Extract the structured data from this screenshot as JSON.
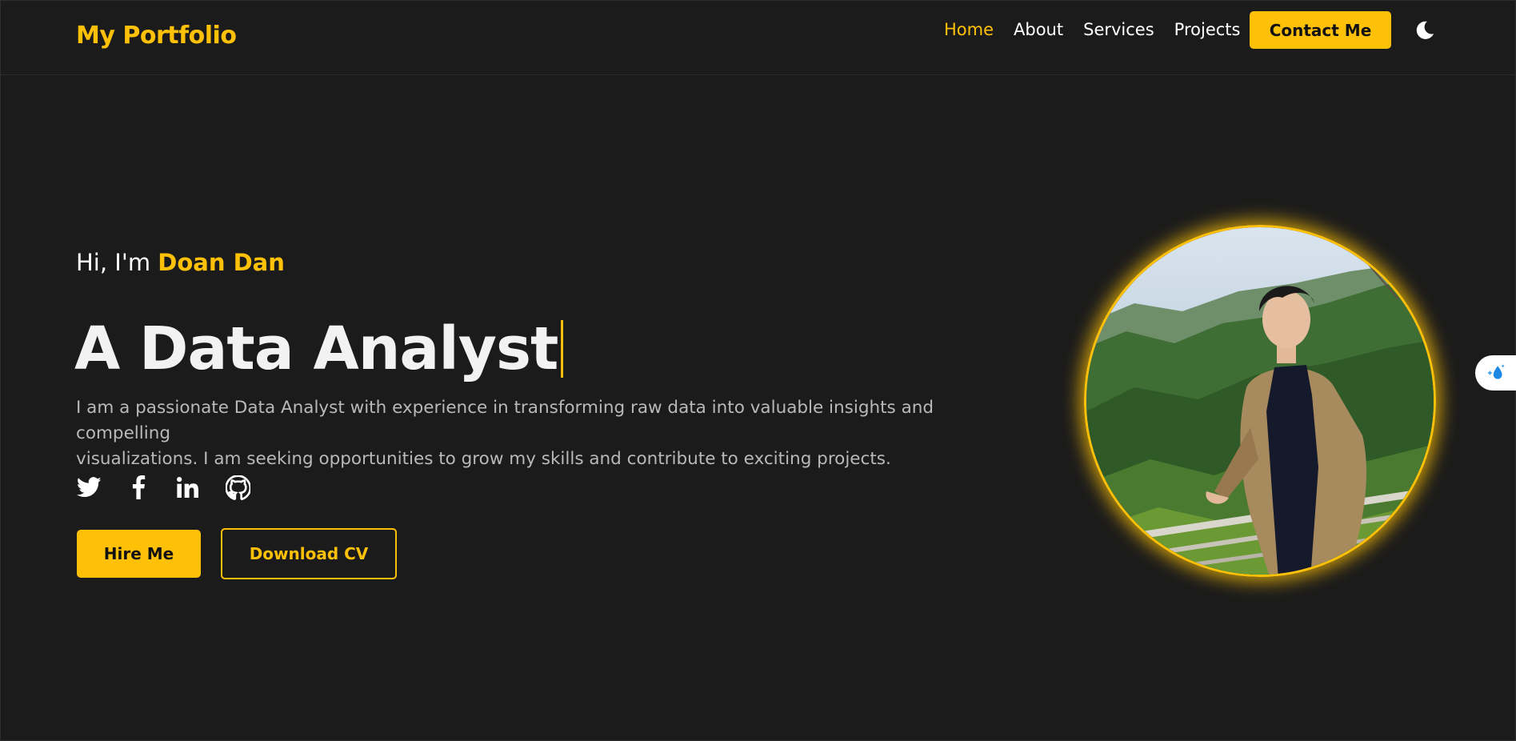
{
  "header": {
    "logo": "My Portfolio",
    "nav": [
      {
        "label": "Home",
        "active": true
      },
      {
        "label": "About",
        "active": false
      },
      {
        "label": "Services",
        "active": false
      },
      {
        "label": "Projects",
        "active": false
      }
    ],
    "contact_label": "Contact Me",
    "theme_icon": "moon-icon"
  },
  "hero": {
    "greeting_prefix": "Hi, I'm",
    "name": "Doan Dan",
    "headline": "A Data Analyst",
    "intro_line1": "I am a passionate Data Analyst with experience in transforming raw data into valuable insights and compelling",
    "intro_line2": "visualizations. I am seeking opportunities to grow my skills and contribute to exciting projects.",
    "socials": [
      "twitter-icon",
      "facebook-icon",
      "linkedin-icon",
      "github-icon"
    ],
    "hire_label": "Hire Me",
    "cv_label": "Download CV"
  },
  "colors": {
    "accent": "#ffc107",
    "background": "#1b1b1b",
    "text": "#ffffff",
    "muted": "#b9b9b9"
  }
}
